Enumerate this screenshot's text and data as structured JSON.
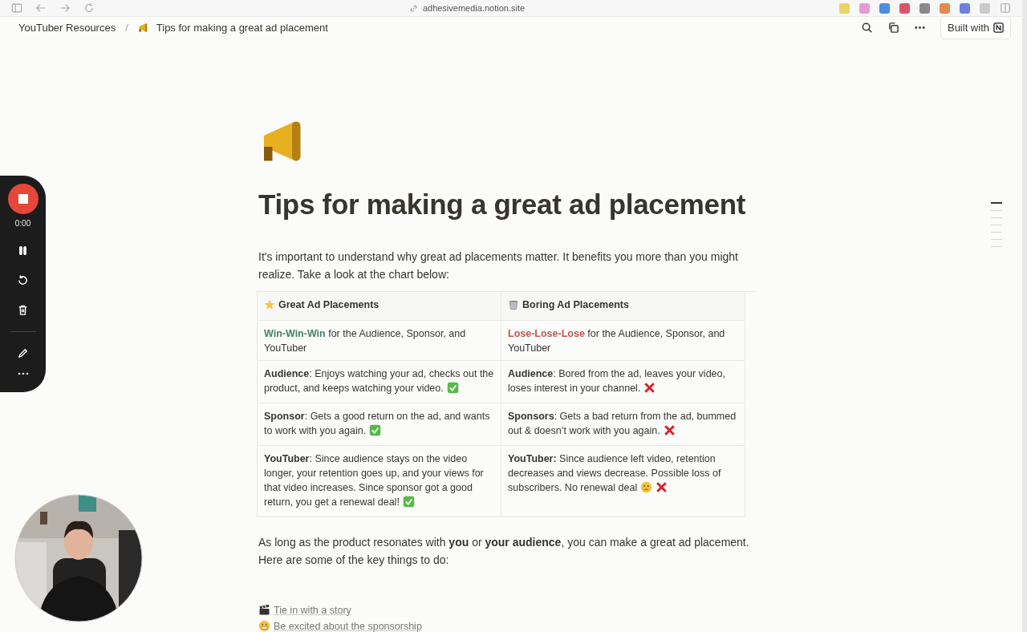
{
  "browser": {
    "url": "adhesivemedia.notion.site",
    "extensions": [
      {
        "color": "#e9d36a"
      },
      {
        "color": "#e59ad6"
      },
      {
        "color": "#4a8fe0"
      },
      {
        "color": "#d9566a"
      },
      {
        "color": "#8a8a8a"
      },
      {
        "color": "#e8894a"
      },
      {
        "color": "#6d7fe0"
      },
      {
        "color": "#c9c9c9"
      }
    ]
  },
  "breadcrumb": {
    "separator": "/",
    "items": [
      {
        "label": "YouTuber Resources"
      },
      {
        "label": "Tips for making a great ad placement"
      }
    ]
  },
  "topbar": {
    "built_with": "Built with"
  },
  "page": {
    "title": "Tips for making a great ad placement",
    "intro": "It's important to understand why great ad placements matter. It benefits you more than you might realize. Take a look at the chart below:",
    "table": {
      "columns": [
        {
          "label": "Great Ad Placements",
          "kind": "star"
        },
        {
          "label": "Boring Ad Placements",
          "kind": "trash"
        }
      ],
      "rows": [
        [
          {
            "highlight": "Win-Win-Win",
            "color": "#448361",
            "text": " for the Audience, Sponsor, and YouTuber"
          },
          {
            "highlight": "Lose-Lose-Lose",
            "color": "#c4554d",
            "text": " for the Audience, Sponsor, and YouTuber"
          }
        ],
        [
          {
            "text": "**Audience**: Enjoys watching your ad, checks out the product, and keeps watching your video.",
            "marks": [
              {
                "kind": "check"
              }
            ]
          },
          {
            "text": "**Audience**: Bored from the ad, leaves your video, loses interest in your channel.",
            "marks": [
              {
                "kind": "cross"
              }
            ]
          }
        ],
        [
          {
            "text": "**Sponsor**: Gets a good return on the ad, and wants to work with you again.",
            "marks": [
              {
                "kind": "check"
              }
            ]
          },
          {
            "text": "**Sponsors**: Gets a bad return from the ad, bummed out & doesn’t work with you again.",
            "marks": [
              {
                "kind": "cross"
              }
            ]
          }
        ],
        [
          {
            "text": "**YouTuber**: Since audience stays on the video longer, your retention goes up, and your views for that video increases. Since sponsor got a good return, you get a renewal deal!",
            "marks": [
              {
                "kind": "check"
              }
            ]
          },
          {
            "text": "**YouTuber:** Since audience left video, retention decreases and views decrease. Possible loss of subscribers. No renewal deal",
            "marks": [
              {
                "kind": "sad"
              },
              {
                "kind": "cross"
              }
            ]
          }
        ]
      ]
    },
    "outro": "As long as the product resonates with **you** or **your audience**, you can make a great ad placement. Here are some of the key things to do:",
    "tips": [
      {
        "kind": "clapper",
        "text": "Tie in with a story"
      },
      {
        "kind": "grin",
        "text": "Be excited about the sponsorship"
      }
    ]
  },
  "outline": [
    {
      "selected": true
    },
    {
      "selected": false
    },
    {
      "selected": false
    },
    {
      "selected": false
    },
    {
      "selected": false
    },
    {
      "selected": false
    },
    {
      "selected": false
    }
  ],
  "recorder": {
    "time": "0:00"
  }
}
